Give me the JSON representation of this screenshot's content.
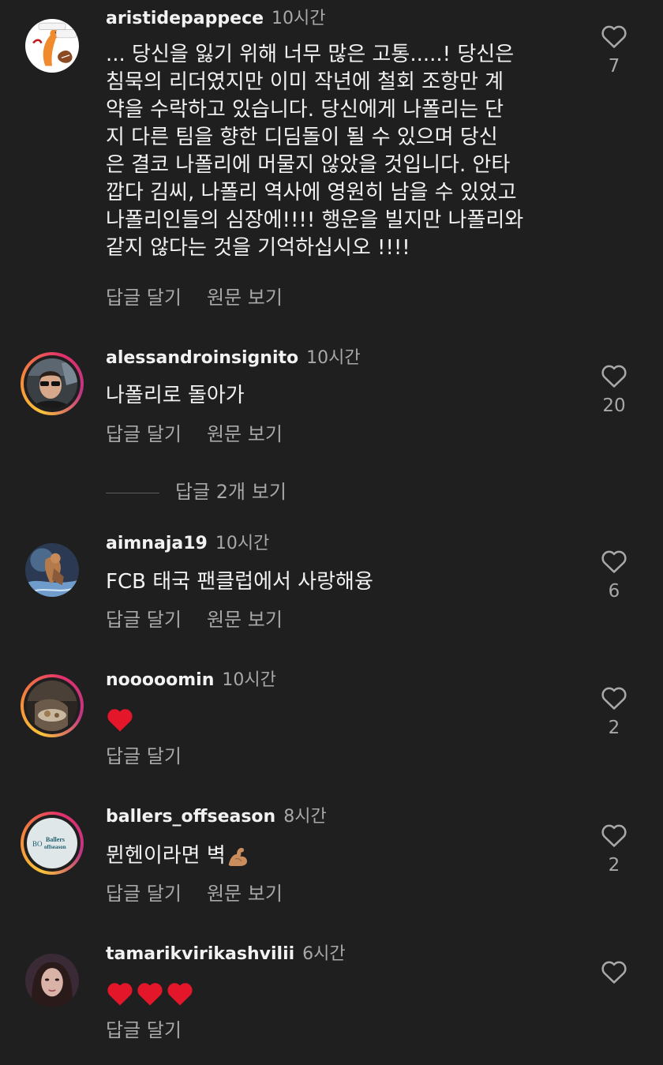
{
  "comments": [
    {
      "username": "aristidepappece",
      "time": "10시간",
      "text_lines": [
        "... 당신을 잃기 위해 너무 많은 고통.....! 당신은",
        "침묵의 리더였지만 이미 작년에 철회 조항만 계",
        "약을 수락하고 있습니다. 당신에게 나폴리는 단",
        "지 다른 팀을 향한 디딤돌이 될 수 있으며 당신",
        "은 결코 나폴리에 머물지 않았을 것입니다. 안타",
        "깝다 김씨, 나폴리 역사에 영원히 남을 수 있었고",
        "나폴리인들의 심장에!!!! 행운을 빌지만 나폴리와",
        "같지 않다는 것을 기억하십시오 !!!!"
      ],
      "reply_label": "답글 달기",
      "translate_label": "원문 보기",
      "likes": "7"
    },
    {
      "username": "alessandroinsignito",
      "time": "10시간",
      "text": "나폴리로 돌아가",
      "reply_label": "답글 달기",
      "translate_label": "원문 보기",
      "likes": "20"
    },
    {
      "username": "aimnaja19",
      "time": "10시간",
      "text": "FCB 태국 팬클럽에서 사랑해융",
      "reply_label": "답글 달기",
      "translate_label": "원문 보기",
      "likes": "6"
    },
    {
      "username": "nooooomin",
      "time": "10시간",
      "emoji": "red-heart",
      "reply_label": "답글 달기",
      "likes": "2"
    },
    {
      "username": "ballers_offseason",
      "time": "8시간",
      "text": "뮌헨이라면 벽",
      "emoji": "flexed-biceps",
      "reply_label": "답글 달기",
      "translate_label": "원문 보기",
      "likes": "2",
      "avatar_logo": {
        "initials": "BO",
        "line1": "Ballers",
        "line2": "offseason"
      }
    },
    {
      "username": "tamarikvirikashvilii",
      "time": "6시간",
      "emoji": "three-red-hearts",
      "reply_label": "답글 달기"
    }
  ],
  "view_replies": "답글 2개 보기",
  "colors": {
    "background": "#1f1f1f",
    "text": "#f2f2f2",
    "secondary": "#a8a8a8",
    "heart": "#e4162a"
  },
  "icons": {
    "like": "heart-outline-icon"
  }
}
